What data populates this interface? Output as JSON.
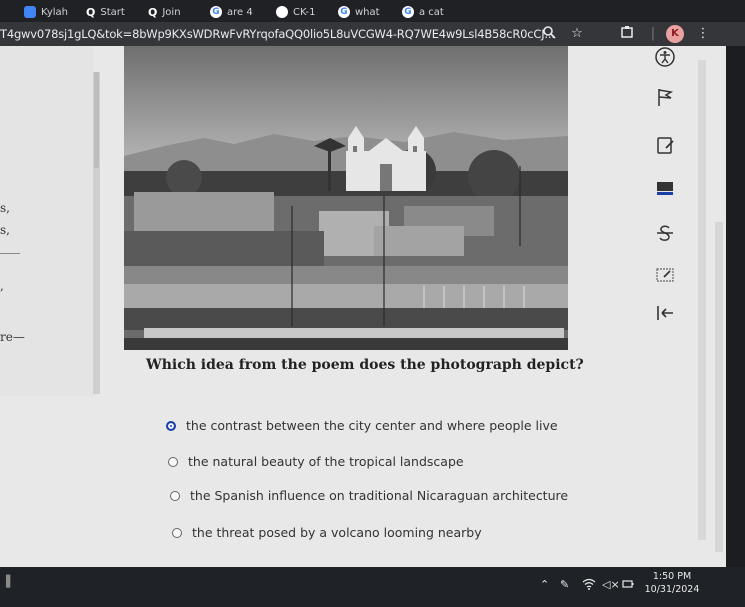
{
  "tabs": [
    {
      "label": "Kylah",
      "icon": "doc-icon",
      "color": "#4285f4"
    },
    {
      "label": "Start",
      "icon": "q-icon",
      "color": "#ffffff"
    },
    {
      "label": "Join",
      "icon": "q-icon",
      "color": "#ffffff"
    },
    {
      "label": "are 4",
      "icon": "google-icon",
      "color": "#ffffff"
    },
    {
      "label": "CK-1",
      "icon": "globe-icon",
      "color": "#ffffff"
    },
    {
      "label": "what",
      "icon": "google-icon",
      "color": "#ffffff"
    },
    {
      "label": "a cat",
      "icon": "google-icon",
      "color": "#ffffff"
    }
  ],
  "address": {
    "url": "T4gwv078sj1gLQ&tok=8bWp9KXsWDRwFvRYrqofaQQ0lio5L8uVCGW4-RQ7WE4w9Lsl4B58cR0cCJ..."
  },
  "profile": {
    "initial": "K"
  },
  "passage": {
    "fragments": [
      "s,",
      "s,",
      ",",
      "re—"
    ]
  },
  "question": {
    "text": "Which idea from the poem does the photograph depict?",
    "options": [
      {
        "label": "the contrast between the city center and where people live",
        "selected": true
      },
      {
        "label": "the natural beauty of the tropical landscape",
        "selected": false
      },
      {
        "label": "the Spanish influence on traditional Nicaraguan architecture",
        "selected": false
      },
      {
        "label": "the threat posed by a volcano looming nearby",
        "selected": false
      }
    ]
  },
  "tools": [
    "accessibility-icon",
    "flag-icon",
    "notepad-icon",
    "highlighter-icon",
    "strikethrough-icon",
    "line-reader-icon",
    "collapse-icon"
  ],
  "taskbar": {
    "time": "1:50 PM",
    "date": "10/31/2024"
  },
  "colors": {
    "selected_radio": "#1a3fa6",
    "page_bg": "#e8e8e8"
  }
}
